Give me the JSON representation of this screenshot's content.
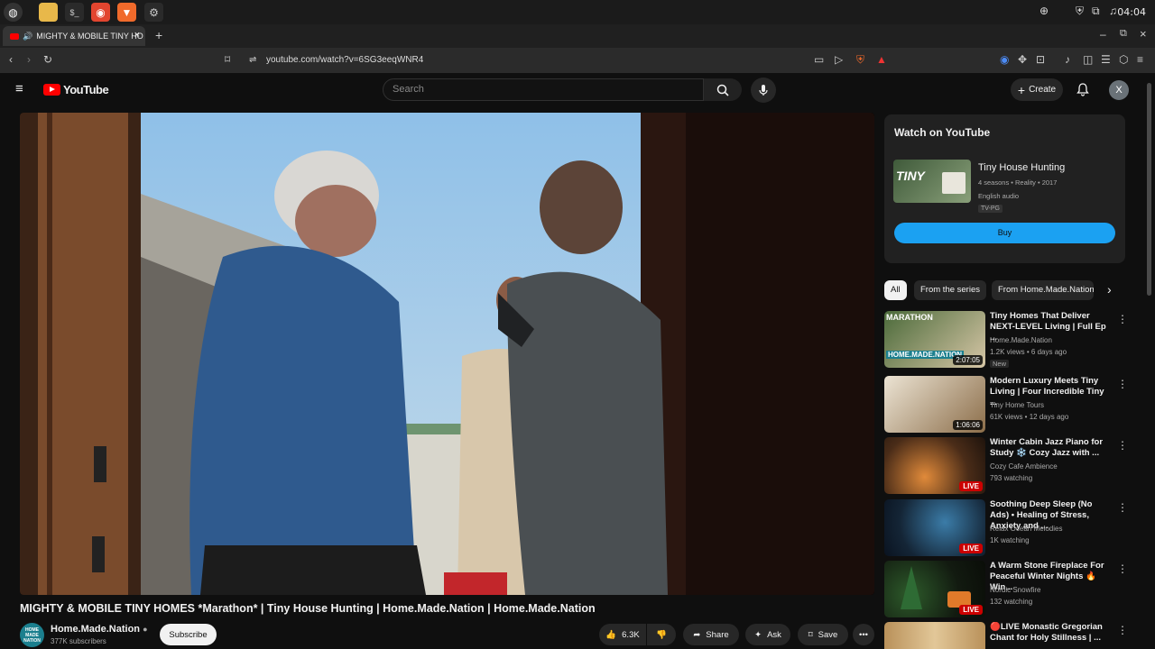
{
  "browser": {
    "tab_title": "MIGHTY & MOBILE TINY HO",
    "url": "youtube.com/watch?v=6SG3eeqWNR4",
    "clock": "04:04"
  },
  "youtube": {
    "logo_text": "YouTube",
    "search_placeholder": "Search",
    "create_label": "Create",
    "avatar_letter": "X"
  },
  "video": {
    "title": "MIGHTY & MOBILE TINY HOMES *Marathon* | Tiny House Hunting | Home.Made.Nation | Home.Made.Nation",
    "channel": "Home.Made.Nation",
    "channel_logo_text": "HOME MADE NATION",
    "subscribers": "377K subscribers",
    "subscribe_label": "Subscribe",
    "likes": "6.3K",
    "share_label": "Share",
    "ask_label": "Ask",
    "save_label": "Save"
  },
  "watch_card": {
    "heading": "Watch on YouTube",
    "show_title": "Tiny House Hunting",
    "meta": "4 seasons • Reality • 2017",
    "audio": "English audio",
    "rating": "TV-PG",
    "buy_label": "Buy",
    "thumb_text": "TINY"
  },
  "chips": [
    "All",
    "From the series",
    "From Home.Made.Nation"
  ],
  "recommendations": [
    {
      "title": "Tiny Homes That Deliver NEXT-LEVEL Living | Full Ep ...",
      "channel": "Home.Made.Nation",
      "meta": "1.2K views • 6 days ago",
      "badge": "2:07:05",
      "new": "New",
      "thumb_text": "MARATHON",
      "thumb_color": "#6d7d54"
    },
    {
      "title": "Modern Luxury Meets Tiny Living | Four Incredible Tiny ...",
      "channel": "Tiny Home Tours",
      "meta": "61K views • 12 days ago",
      "badge": "1:06:06",
      "thumb_text": "",
      "thumb_color": "#b9a88c"
    },
    {
      "title": "Winter Cabin Jazz Piano for Study ❄️ Cozy Jazz with ...",
      "channel": "Cozy Cafe Ambience",
      "meta": "793 watching",
      "live": "LIVE",
      "thumb_text": "",
      "thumb_color": "#5a3a22"
    },
    {
      "title": "Soothing Deep Sleep (No Ads) • Healing of Stress, Anxiety and ...",
      "channel": "Relax Ocean Melodies",
      "meta": "1K watching",
      "live": "LIVE",
      "thumb_text": "",
      "thumb_color": "#1d3650"
    },
    {
      "title": "A Warm Stone Fireplace For Peaceful Winter Nights 🔥 Win...",
      "channel": "Nordic Snowfire",
      "meta": "132 watching",
      "live": "LIVE",
      "thumb_text": "",
      "thumb_color": "#23301f"
    },
    {
      "title": "🔴LIVE Monastic Gregorian Chant for Holy Stillness | ...",
      "channel": "",
      "meta": "",
      "thumb_text": "",
      "thumb_color": "#c9a36a"
    }
  ],
  "colors": {
    "youtube_red": "#ff0000",
    "buy_blue": "#1ba1f2",
    "live_red": "#cc0000"
  }
}
